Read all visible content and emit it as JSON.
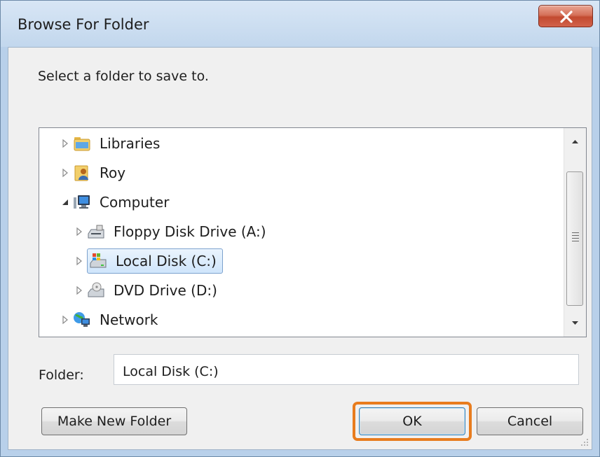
{
  "window": {
    "title": "Browse For Folder",
    "close_label": "close"
  },
  "dialog": {
    "prompt": "Select a folder to save to."
  },
  "tree": {
    "items": [
      {
        "label": "Libraries",
        "icon": "libraries-icon",
        "expanded": false,
        "level": 0
      },
      {
        "label": "Roy",
        "icon": "user-folder-icon",
        "expanded": false,
        "level": 0
      },
      {
        "label": "Computer",
        "icon": "computer-icon",
        "expanded": true,
        "level": 0
      },
      {
        "label": "Floppy Disk Drive (A:)",
        "icon": "floppy-drive-icon",
        "expanded": false,
        "level": 1
      },
      {
        "label": "Local Disk (C:)",
        "icon": "local-disk-icon",
        "expanded": false,
        "level": 1,
        "selected": true
      },
      {
        "label": "DVD Drive (D:)",
        "icon": "dvd-drive-icon",
        "expanded": false,
        "level": 1
      },
      {
        "label": "Network",
        "icon": "network-icon",
        "expanded": false,
        "level": 0
      }
    ]
  },
  "folder": {
    "label": "Folder:",
    "value": "Local Disk (C:)"
  },
  "buttons": {
    "make_new_folder": "Make New Folder",
    "ok": "OK",
    "cancel": "Cancel"
  },
  "colors": {
    "highlight": "#e87c1e",
    "selection": "#cfe5fb"
  }
}
